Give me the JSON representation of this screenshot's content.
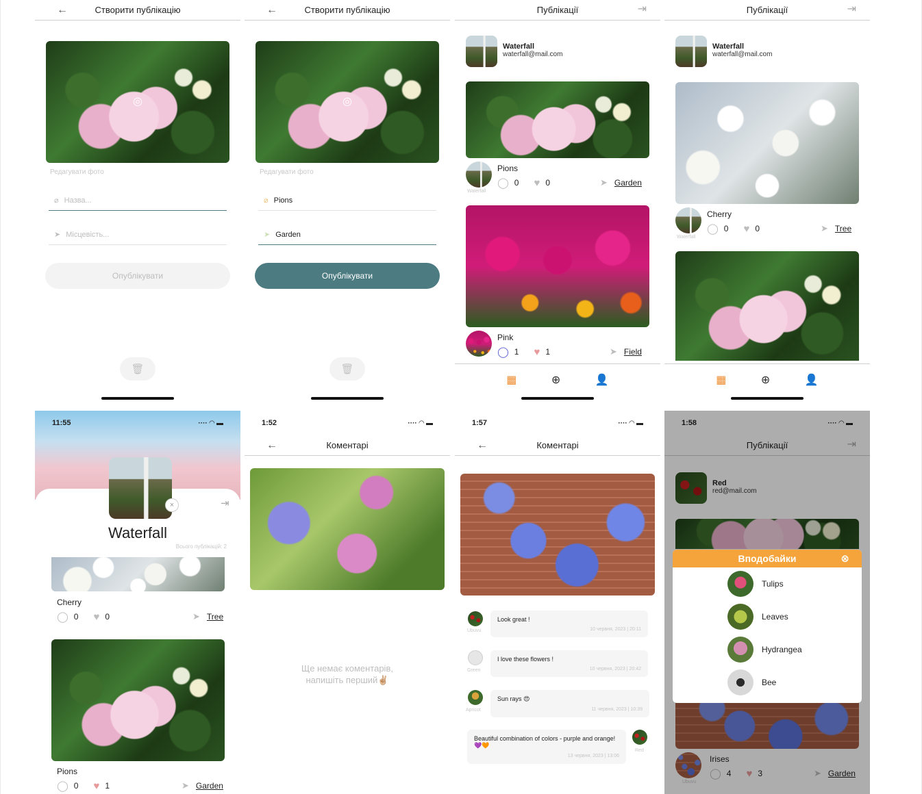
{
  "screens": {
    "create_empty": {
      "title": "Створити публікацію",
      "edit_photo": "Редагувати фото",
      "name_placeholder": "Назва...",
      "location_placeholder": "Місцевість...",
      "publish_label": "Опублікувати"
    },
    "create_filled": {
      "title": "Створити публікацію",
      "edit_photo": "Редагувати фото",
      "name_value": "Pions",
      "location_value": "Garden",
      "publish_label": "Опублікувати"
    },
    "posts_a": {
      "title": "Публікації",
      "user_name": "Waterfall",
      "user_email": "waterfall@mail.com",
      "posts": [
        {
          "title": "Pions",
          "comments": "0",
          "likes": "0",
          "location": "Garden",
          "author": "Waterfall"
        },
        {
          "title": "Pink",
          "comments": "1",
          "likes": "1",
          "location": "Field",
          "author": ""
        }
      ]
    },
    "posts_b": {
      "title": "Публікації",
      "user_name": "Waterfall",
      "user_email": "waterfall@mail.com",
      "posts": [
        {
          "title": "Cherry",
          "comments": "0",
          "likes": "0",
          "location": "Tree",
          "author": "Waterfall"
        }
      ]
    },
    "profile": {
      "time": "11:55",
      "name": "Waterfall",
      "total": "Всього публікацій: 2",
      "posts": [
        {
          "title": "Cherry",
          "comments": "0",
          "likes": "0",
          "location": "Tree"
        },
        {
          "title": "Pions",
          "comments": "0",
          "likes": "1",
          "location": "Garden"
        }
      ]
    },
    "comments_empty": {
      "time": "1:52",
      "title": "Коментарі",
      "empty_line1": "Ще немає коментарів,",
      "empty_line2": "напишіть перший✌🏼"
    },
    "comments_list": {
      "time": "1:57",
      "title": "Коментарі",
      "comments": [
        {
          "author": "Ubuvu",
          "text": "Look great !",
          "date": "10 червня, 2023 | 20:11"
        },
        {
          "author": "Green",
          "text": "I love these flowers !",
          "date": "10 червня, 2023 | 20:42"
        },
        {
          "author": "Apricot",
          "text": "Sun rays 😍",
          "date": "11 червня, 2023 | 10:39"
        },
        {
          "author": "Red",
          "text": "Beautiful combination of colors - purple and orange!💜🧡",
          "date": "13 червня, 2023 | 13:06"
        }
      ]
    },
    "likes_modal": {
      "time": "1:58",
      "title": "Публікації",
      "user_name": "Red",
      "user_email": "red@mail.com",
      "modal_title": "Вподобайки",
      "likers": [
        "Tulips",
        "Leaves",
        "Hydrangea",
        "Bee"
      ],
      "post": {
        "title": "Irises",
        "comments": "4",
        "likes": "3",
        "location": "Garden",
        "author": "Ubuvu"
      }
    }
  },
  "icons": {
    "back": "arrow-left-icon",
    "logout": "logout-icon",
    "camera": "camera-icon",
    "clip": "paperclip-icon",
    "location": "location-arrow-icon",
    "trash": "trash-icon",
    "comment": "comment-icon",
    "heart": "heart-icon",
    "grid": "grid-icon",
    "add": "add-icon",
    "user": "user-icon"
  },
  "colors": {
    "accent_teal": "#4c7b82",
    "accent_orange": "#f4a43a",
    "grid_orange": "#ef8b2e",
    "heart_red": "#e89a9a"
  }
}
